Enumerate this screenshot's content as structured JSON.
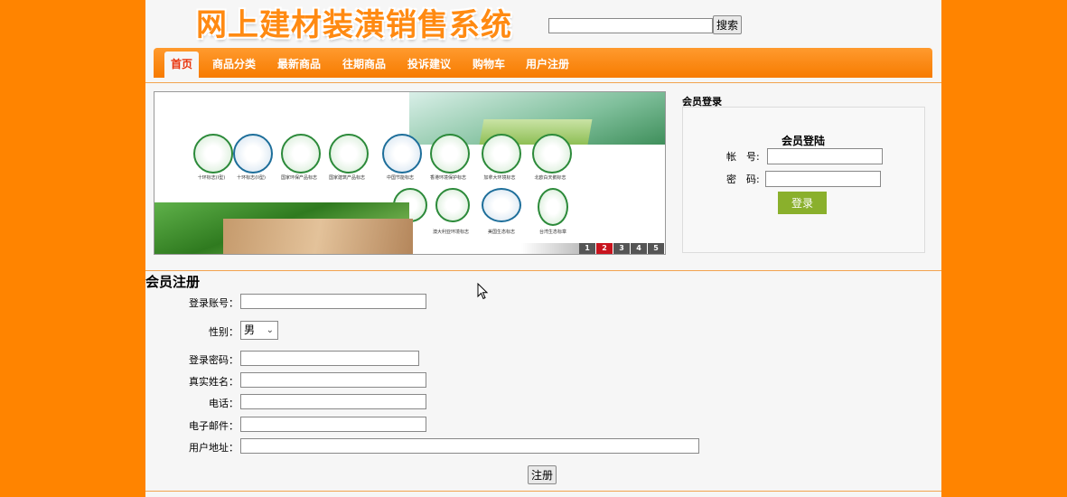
{
  "header": {
    "logo_text": "网上建材装潢销售系统",
    "search": {
      "value": "",
      "button_label": "搜索"
    }
  },
  "nav": {
    "items": [
      {
        "label": "首页",
        "active": true
      },
      {
        "label": "商品分类"
      },
      {
        "label": "最新商品"
      },
      {
        "label": "往期商品"
      },
      {
        "label": "投诉建议"
      },
      {
        "label": "购物车"
      },
      {
        "label": "用户注册"
      }
    ]
  },
  "banner": {
    "slides": [
      "1",
      "2",
      "3",
      "4",
      "5"
    ],
    "active_slide": "2",
    "cert_captions": [
      "十环标志(I型)",
      "十环标志(II型)",
      "国家环保产品标志",
      "国家建筑产品标志",
      "中国节能标志",
      "香港环境保护标志",
      "加拿大环境标志",
      "北欧白天鹅标志",
      "澳大利亚环境标志",
      "美国生态标志",
      "台湾生态标章"
    ]
  },
  "login": {
    "heading": "会员登录",
    "title": "会员登陆",
    "account_label": "帐　号:",
    "password_label": "密　码:",
    "button_label": "登录"
  },
  "register": {
    "title": "会员注册",
    "fields": {
      "account": "登录账号：",
      "gender": "性别：",
      "password": "登录密码：",
      "realname": "真实姓名：",
      "phone": "电话：",
      "email": "电子邮件：",
      "address": "用户地址："
    },
    "gender_value": "男",
    "submit_label": "注册"
  },
  "colors": {
    "background": "#ff8400",
    "nav": "#f77b00",
    "active_tab_text": "#e8320b",
    "login_button": "#8ab02c"
  }
}
